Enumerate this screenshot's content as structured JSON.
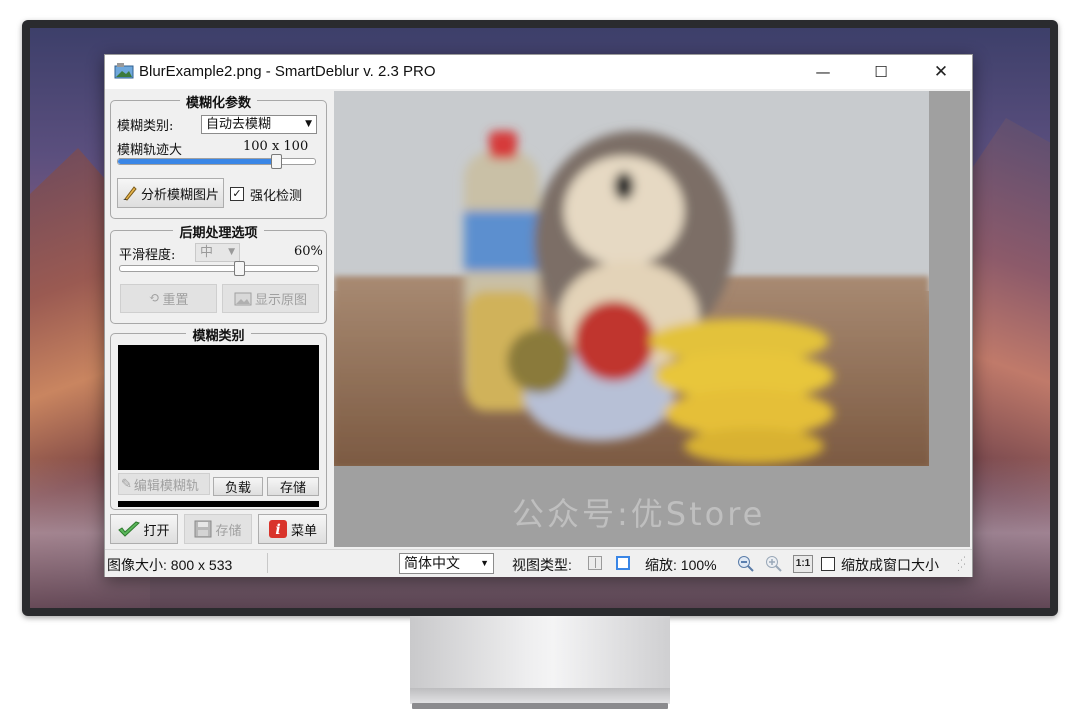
{
  "window": {
    "title": "BlurExample2.png - SmartDeblur v. 2.3 PRO",
    "controls": {
      "minimize": "—",
      "maximize": "☐",
      "close": "✕"
    }
  },
  "blur_params": {
    "title": "模糊化参数",
    "type_label": "模糊类别:",
    "type_value": "自动去模糊",
    "trace_label": "模糊轨迹大",
    "trace_value": "100  x  100",
    "trace_slider_fraction": 0.8,
    "analyze_button": "分析模糊图片",
    "enhance_label": "强化检测",
    "enhance_checked": true
  },
  "post": {
    "title": "后期处理选项",
    "smooth_label": "平滑程度:",
    "smooth_value": "中",
    "smooth_percent": "60%",
    "smooth_fraction": 0.6,
    "reset_button": "重置",
    "show_original_button": "显示原图"
  },
  "blur_kind": {
    "title": "模糊类别",
    "edit_button": "编辑模糊轨",
    "load_button": "负载",
    "save_button": "存储"
  },
  "bottom_buttons": {
    "open": "打开",
    "save": "存储",
    "menu": "菜单"
  },
  "watermark": "公众号:优Store",
  "status": {
    "image_size": "图像大小: 800 x 533",
    "language": "简体中文",
    "view_type_label": "视图类型:",
    "zoom": "缩放: 100%",
    "one_to_one": "1:1",
    "fit_label": "缩放成窗口大小"
  }
}
